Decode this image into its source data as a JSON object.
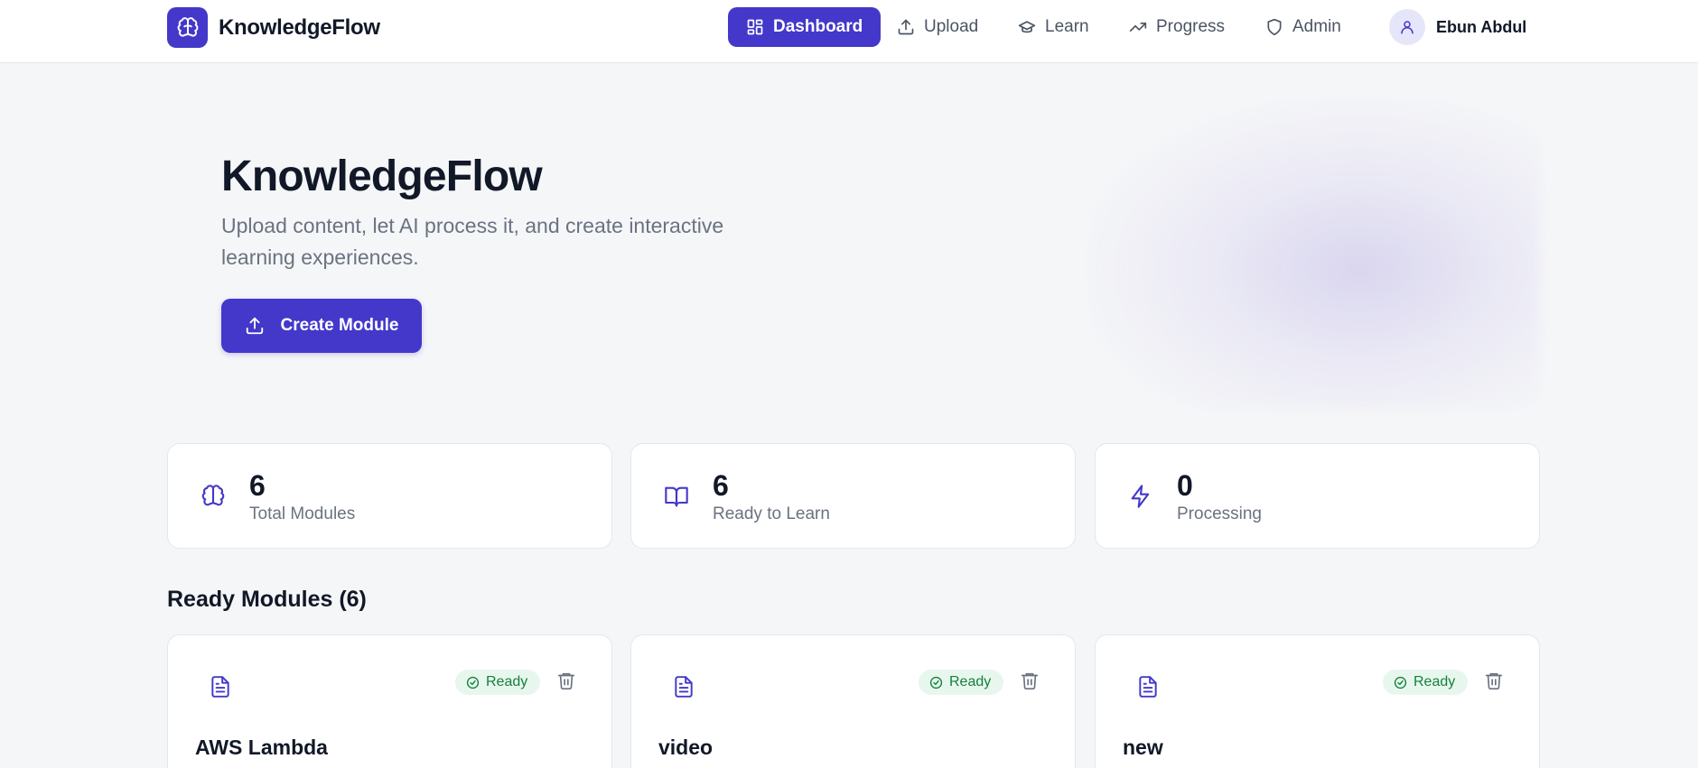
{
  "app": {
    "brand": "KnowledgeFlow"
  },
  "nav": {
    "items": [
      {
        "label": "Dashboard",
        "icon": "grid-icon",
        "active": true
      },
      {
        "label": "Upload",
        "icon": "upload-icon",
        "active": false
      },
      {
        "label": "Learn",
        "icon": "graduation-cap-icon",
        "active": false
      },
      {
        "label": "Progress",
        "icon": "trending-up-icon",
        "active": false
      },
      {
        "label": "Admin",
        "icon": "shield-icon",
        "active": false
      }
    ],
    "user": {
      "name": "Ebun Abdul",
      "icon": "user-icon"
    }
  },
  "hero": {
    "title": "KnowledgeFlow",
    "subtitle": "Upload content, let AI process it, and create interactive learning experiences.",
    "cta_label": "Create Module"
  },
  "stats": [
    {
      "value": "6",
      "label": "Total Modules",
      "icon": "brain-icon"
    },
    {
      "value": "6",
      "label": "Ready to Learn",
      "icon": "book-open-icon"
    },
    {
      "value": "0",
      "label": "Processing",
      "icon": "zap-icon"
    }
  ],
  "modules": {
    "section_title": "Ready Modules (6)",
    "items": [
      {
        "title": "AWS Lambda",
        "status": "Ready"
      },
      {
        "title": "video",
        "status": "Ready"
      },
      {
        "title": "new",
        "status": "Ready"
      }
    ]
  },
  "colors": {
    "accent": "#4338ca",
    "background": "#f5f6f8",
    "ready_bg": "#e8f7ee",
    "ready_text": "#15803d"
  }
}
